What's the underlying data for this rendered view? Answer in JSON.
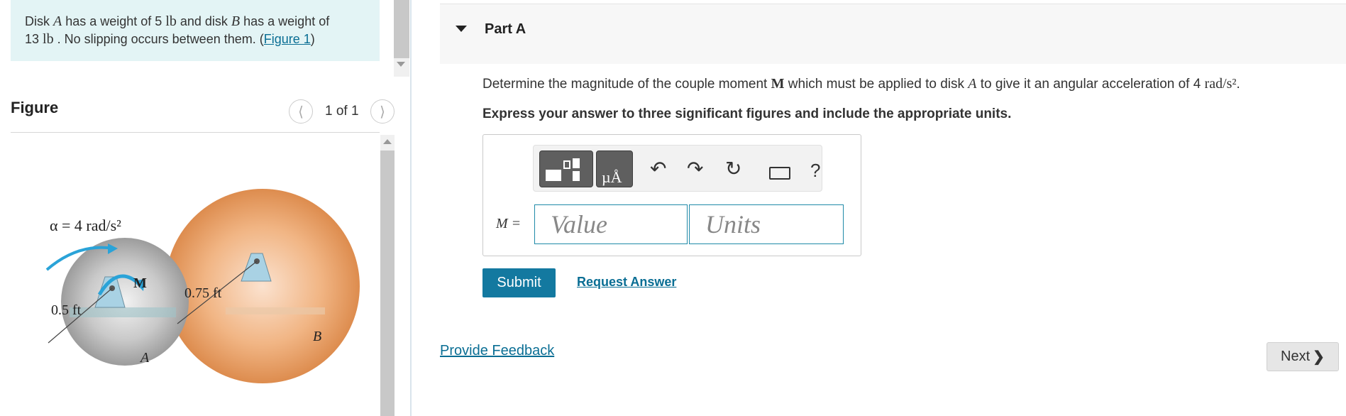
{
  "problem": {
    "t1": "Disk ",
    "diskA": "A",
    "t2": " has a weight of 5 ",
    "lb1": "lb",
    "t3": " and disk ",
    "diskB": "B",
    "t4": " has a weight of",
    "w2": "13 ",
    "lb2": "lb",
    "t5": " . No slipping occurs between them. (",
    "figure_link": "Figure 1",
    "t6": ")"
  },
  "figure_panel": {
    "title": "Figure",
    "count": "1 of 1",
    "prev_icon": "chevron-left-icon",
    "next_icon": "chevron-right-icon"
  },
  "figure": {
    "alpha_label": "α = 4 rad/s²",
    "moment_label": "M",
    "radius_a": "0.5 ft",
    "radius_b": "0.75 ft",
    "disk_a": "A",
    "disk_b": "B"
  },
  "part": {
    "title": "Part A",
    "toggle_icon": "caret-down-icon"
  },
  "question": {
    "q1": "Determine the magnitude of the couple moment ",
    "M": "M",
    "q2": " which must be applied to disk ",
    "A": "A",
    "q3": " to give it an angular acceleration of 4 ",
    "unit": "rad/s²",
    "q4": ".",
    "instruction": "Express your answer to three significant figures and include the appropriate units."
  },
  "toolbar": {
    "icons": [
      "templates-icon",
      "units-icon",
      "undo-icon",
      "redo-icon",
      "reset-icon",
      "keyboard-icon",
      "help-icon"
    ],
    "undo": "↶",
    "redo": "↷",
    "reset": "↻",
    "help": "?"
  },
  "answer": {
    "label": "M =",
    "value_placeholder": "Value",
    "units_placeholder": "Units"
  },
  "actions": {
    "submit": "Submit",
    "request_answer": "Request Answer",
    "provide_feedback": "Provide Feedback",
    "next": "Next"
  },
  "colors": {
    "problem_bg": "#e3f4f5",
    "link": "#0a6e94",
    "submit_bg": "#1379a0",
    "disk_a": "#c4c4c4",
    "disk_b": "#f0b27d",
    "arrow": "#2aa3d8"
  }
}
